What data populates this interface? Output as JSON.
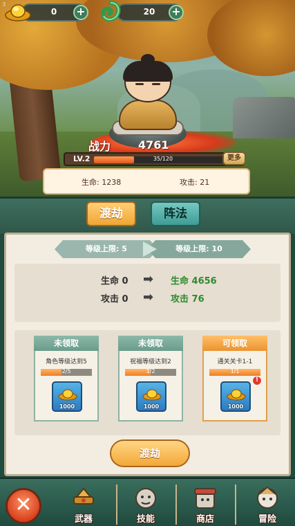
{
  "topbar": {
    "corner_num": "3",
    "gold": {
      "value": "0",
      "icon": "gold-ingot-icon"
    },
    "jade": {
      "value": "20",
      "icon": "jade-dragon-icon"
    }
  },
  "hero_panel": {
    "power_label": "战力",
    "power_value": "4761",
    "level": "LV.2",
    "exp_text": "35/120",
    "exp_progress": 0.29,
    "more_label": "更多",
    "hp_label": "生命: 1238",
    "atk_label": "攻击: 21"
  },
  "tabs": [
    {
      "label": "渡劫",
      "active": true
    },
    {
      "label": "阵法",
      "active": false
    }
  ],
  "level_caps": {
    "current": "等级上限: 5",
    "next": "等级上限: 10"
  },
  "attributes": [
    {
      "from": "生命 0",
      "to": "生命 4656"
    },
    {
      "from": "攻击 0",
      "to": "攻击 76"
    }
  ],
  "tasks": [
    {
      "status": "未领取",
      "desc": "角色等级达到5",
      "progress_text": "2/5",
      "progress": 0.4,
      "reward": "1000",
      "claimable": false
    },
    {
      "status": "未领取",
      "desc": "祝福等级达到2",
      "progress_text": "1/2",
      "progress": 0.5,
      "reward": "1000",
      "claimable": false
    },
    {
      "status": "可领取",
      "desc": "通关关卡1-1",
      "progress_text": "1/1",
      "progress": 1.0,
      "reward": "1000",
      "claimable": true,
      "badge": "!"
    }
  ],
  "action_button": "渡劫",
  "nav": {
    "close_label": "✕",
    "items": [
      {
        "label": "武器",
        "icon": "weapon-icon"
      },
      {
        "label": "技能",
        "icon": "skill-icon"
      },
      {
        "label": "商店",
        "icon": "shop-icon"
      },
      {
        "label": "冒险",
        "icon": "adventure-icon"
      }
    ]
  },
  "colors": {
    "accent_orange": "#f0a634",
    "teal": "#3f9c94",
    "green_text": "#2e8a2e",
    "dark_green": "#1f4a3e"
  }
}
